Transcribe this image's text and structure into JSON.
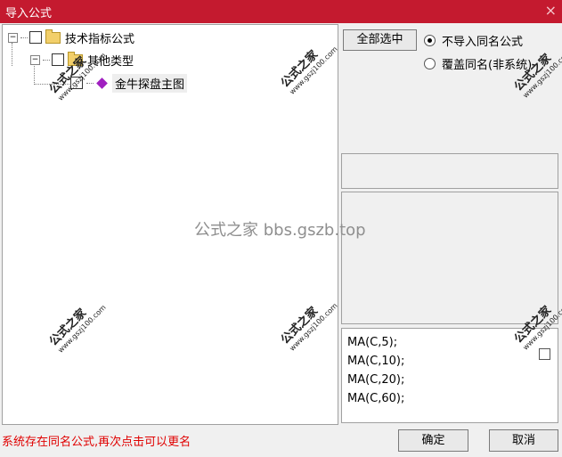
{
  "window": {
    "title": "导入公式",
    "close_glyph": "×"
  },
  "tree": {
    "root": {
      "label": "技术指标公式",
      "expand": "−"
    },
    "child": {
      "label": "其他类型",
      "expand": "−"
    },
    "leaf": {
      "label": "金牛探盘主图"
    }
  },
  "toolbar": {
    "select_all": "全部选中"
  },
  "options": {
    "no_import_same": "不导入同名公式",
    "overwrite_same": "覆盖同名(非系统)"
  },
  "formula_lines": [
    "MA(C,5);",
    "MA(C,10);",
    "MA(C,20);",
    "MA(C,60);"
  ],
  "watermark": {
    "center": "公式之家 bbs.gszb.top",
    "stamp_main": "公式之家",
    "stamp_url": "www.gszj100.com"
  },
  "status": "系统存在同名公式,再次点击可以更名",
  "buttons": {
    "ok": "确定",
    "cancel": "取消"
  },
  "colors": {
    "titlebar": "#c41a2f",
    "status": "#e00000"
  }
}
